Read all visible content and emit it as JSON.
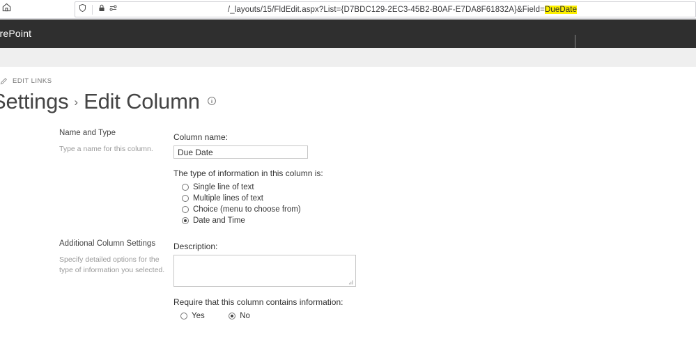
{
  "browser": {
    "home_icon": "home-icon",
    "shield_icon": "shield-icon",
    "lock_icon": "padlock-icon",
    "permissions_icon": "permissions-icon",
    "url_prefix": "/_layouts/15/FldEdit.aspx?List={D7BDC129-2EC3-45B2-B0AF-E7DA8F61832A}&Field=",
    "url_highlighted": "DueDate",
    "highlight_color": "#fdf000"
  },
  "suite_bar": {
    "brand": "SharePoint",
    "background": "#2f2f2f"
  },
  "page": {
    "edit_links_label": "EDIT LINKS",
    "edit_links_icon": "pencil-icon",
    "breadcrumb_parent": "Settings",
    "breadcrumb_separator": "›",
    "breadcrumb_current": "Edit Column",
    "info_icon": "info-icon"
  },
  "sections": {
    "name_and_type": {
      "heading": "Name and Type",
      "description": "Type a name for this column.",
      "column_name_label": "Column name:",
      "column_name_value": "Due Date",
      "type_label": "The type of information in this column is:",
      "type_options": [
        {
          "label": "Single line of text",
          "checked": false
        },
        {
          "label": "Multiple lines of text",
          "checked": false
        },
        {
          "label": "Choice (menu to choose from)",
          "checked": false
        },
        {
          "label": "Date and Time",
          "checked": true
        }
      ]
    },
    "additional_settings": {
      "heading": "Additional Column Settings",
      "description": "Specify detailed options for the type of information you selected.",
      "description_label": "Description:",
      "description_value": "",
      "require_label": "Require that this column contains information:",
      "require_options": [
        {
          "label": "Yes",
          "checked": false
        },
        {
          "label": "No",
          "checked": true
        }
      ]
    }
  }
}
